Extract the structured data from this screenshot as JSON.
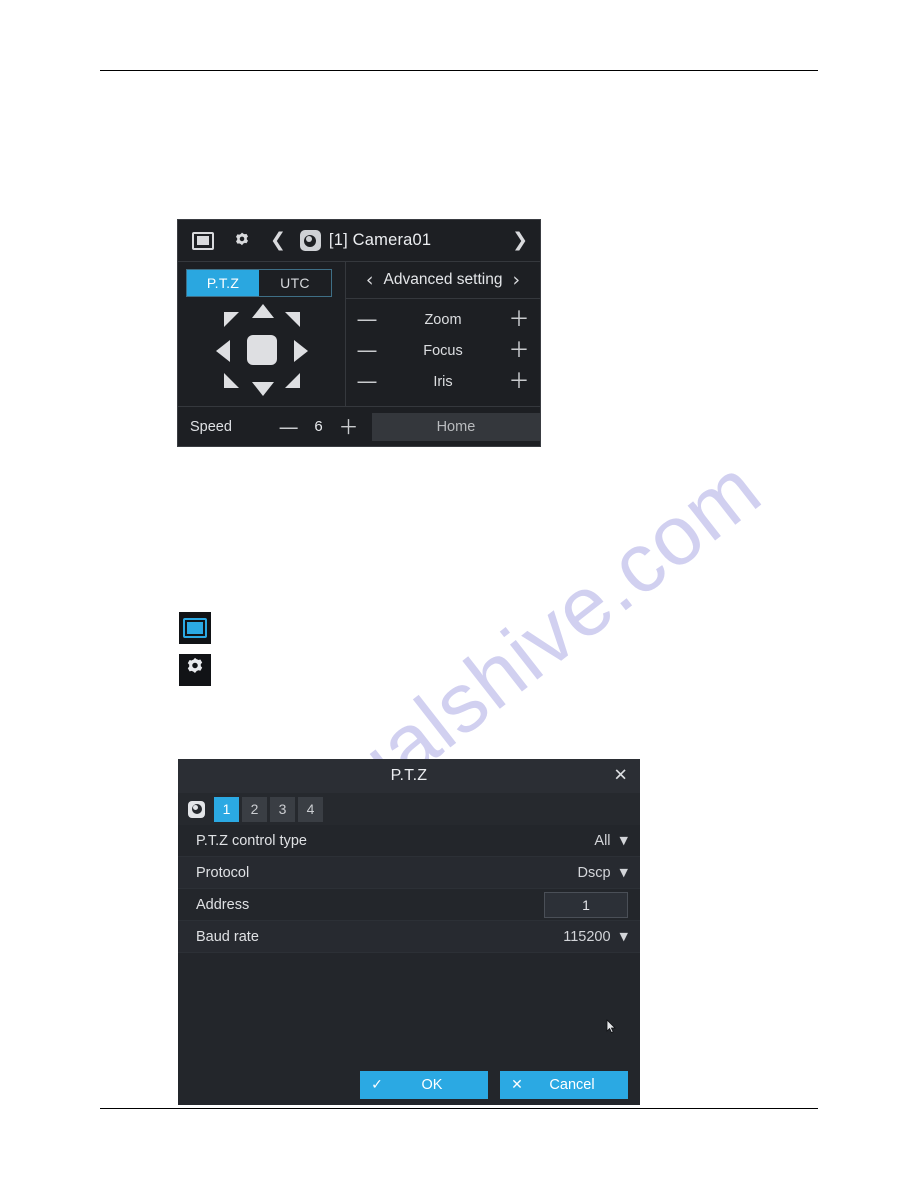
{
  "page": {
    "watermark": "manualshive.com",
    "rule_color": "#000000"
  },
  "ptz_control_panel": {
    "header": {
      "window_icon": "window-layout-icon",
      "gear_icon": "gear-icon",
      "prev_icon": "chevron-left-icon",
      "camera_icon": "camera-icon",
      "camera_title": "[1] Camera01",
      "next_icon": "chevron-right-icon"
    },
    "tabs": [
      {
        "label": "P.T.Z",
        "active": true
      },
      {
        "label": "UTC",
        "active": false
      }
    ],
    "dpad": {
      "up": "arrow-up",
      "down": "arrow-down",
      "left": "arrow-left",
      "right": "arrow-right",
      "up_left": "arrow-up-left",
      "up_right": "arrow-up-right",
      "down_left": "arrow-down-left",
      "down_right": "arrow-down-right",
      "center": "center-button"
    },
    "advanced": {
      "prev": "‹",
      "label": "Advanced setting",
      "next": "›"
    },
    "lens_rows": [
      {
        "minus": "—",
        "label": "Zoom",
        "plus": "＋"
      },
      {
        "minus": "—",
        "label": "Focus",
        "plus": "＋"
      },
      {
        "minus": "—",
        "label": "Iris",
        "plus": "＋"
      }
    ],
    "footer": {
      "speed_label": "Speed",
      "minus": "—",
      "speed_value": "6",
      "plus": "＋",
      "home_label": "Home"
    },
    "colors": {
      "panel_bg": "#1d1f23",
      "accent": "#2aa7e0",
      "text": "#e6e7ea"
    }
  },
  "icon_samples": [
    {
      "name": "window-layout-icon",
      "accent": "#2ba9e3"
    },
    {
      "name": "gear-icon",
      "accent": "#e8eaed"
    }
  ],
  "ptz_dialog": {
    "title": "P.T.Z",
    "close": "✕",
    "channel_camera_icon": "camera-icon",
    "channels": [
      {
        "label": "1",
        "active": true
      },
      {
        "label": "2",
        "active": false
      },
      {
        "label": "3",
        "active": false
      },
      {
        "label": "4",
        "active": false
      }
    ],
    "rows": [
      {
        "label": "P.T.Z control type",
        "value": "All",
        "type": "select"
      },
      {
        "label": "Protocol",
        "value": "Dscp",
        "type": "select"
      },
      {
        "label": "Address",
        "value": "1",
        "type": "input"
      },
      {
        "label": "Baud rate",
        "value": "115200",
        "type": "select"
      }
    ],
    "caret": "⌄",
    "buttons": [
      {
        "icon": "✓",
        "label": "OK"
      },
      {
        "icon": "✕",
        "label": "Cancel"
      }
    ],
    "colors": {
      "dialog_bg": "#23262b",
      "title_bg": "#2b2e34",
      "accent": "#2ba9e3"
    }
  }
}
